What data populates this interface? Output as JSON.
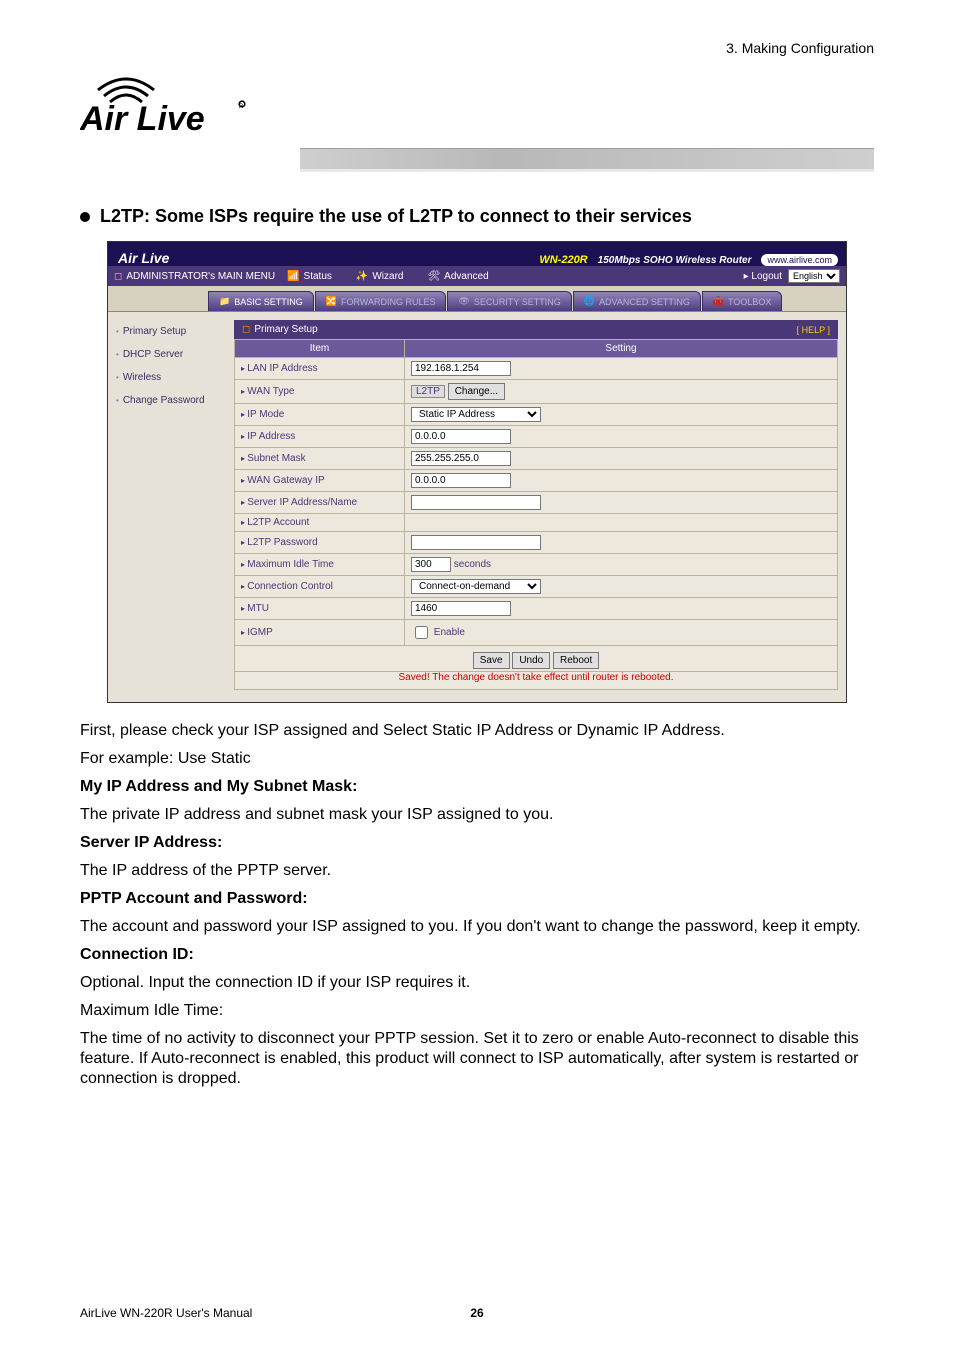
{
  "doc": {
    "chapter": "3. Making Configuration",
    "bullet_title": "L2TP: Some ISPs require the use of   L2TP to connect to their services",
    "p1": "First, please check your ISP assigned and Select Static IP Address or Dynamic IP Address.",
    "p2": "For example: Use Static",
    "h_ip_mask": "My IP Address and My Subnet Mask:",
    "p3": "The private IP address and subnet mask your ISP assigned to you.",
    "h_server": "Server IP Address:",
    "p4": "The IP address of the PPTP server.",
    "h_acct": "PPTP Account and Password:",
    "p5": "The account and password your ISP assigned to you. If you don't want to change the password, keep it empty.",
    "h_cid": "Connection ID:",
    "p6": "Optional. Input the connection ID if your ISP requires it.",
    "p7": "Maximum Idle Time:",
    "p8": "The time of no activity to disconnect your PPTP session. Set it to zero or enable Auto-reconnect to disable this feature. If Auto-reconnect is enabled, this product will connect to ISP automatically, after system is restarted or connection is dropped.",
    "footer": "AirLive WN-220R User's Manual",
    "page_no": "26"
  },
  "ui": {
    "brand": "Air Live",
    "url_pill": "www.airlive.com",
    "product": "WN-220R",
    "product_sub": "150Mbps SOHO Wireless Router",
    "admin_menu": "ADMINISTRATOR's MAIN MENU",
    "status": "Status",
    "wizard": "Wizard",
    "advanced": "Advanced",
    "logout": "▸ Logout",
    "lang_value": "English",
    "tabs": {
      "basic": "BASIC SETTING",
      "fwd": "FORWARDING RULES",
      "sec": "SECURITY SETTING",
      "adv": "ADVANCED SETTING",
      "tool": "TOOLBOX"
    },
    "side": {
      "a": "Primary Setup",
      "b": "DHCP Server",
      "c": "Wireless",
      "d": "Change Password"
    },
    "panel_title": "Primary Setup",
    "help": "[ HELP ]",
    "col_item": "Item",
    "col_setting": "Setting",
    "rows": {
      "lan_ip": "LAN IP Address",
      "wan_type": "WAN Type",
      "ip_mode": "IP Mode",
      "ip_addr": "IP Address",
      "subnet": "Subnet Mask",
      "wan_gw": "WAN Gateway IP",
      "server_ip": "Server IP Address/Name",
      "l2tp_acc": "L2TP Account",
      "l2tp_pwd": "L2TP Password",
      "max_idle": "Maximum Idle Time",
      "conn_ctrl": "Connection Control",
      "mtu": "MTU",
      "igmp": "IGMP"
    },
    "values": {
      "lan_ip": "192.168.1.254",
      "wan_type_badge": "L2TP",
      "change_btn": "Change...",
      "ip_mode": "Static IP Address",
      "ip_addr": "0.0.0.0",
      "subnet": "255.255.255.0",
      "wan_gw": "0.0.0.0",
      "max_idle": "300",
      "max_idle_unit": "seconds",
      "conn_ctrl": "Connect-on-demand",
      "mtu": "1460",
      "igmp_enable": "Enable"
    },
    "buttons": {
      "save": "Save",
      "undo": "Undo",
      "reboot": "Reboot"
    },
    "saved_note": "Saved! The change doesn't take effect until router is rebooted."
  }
}
